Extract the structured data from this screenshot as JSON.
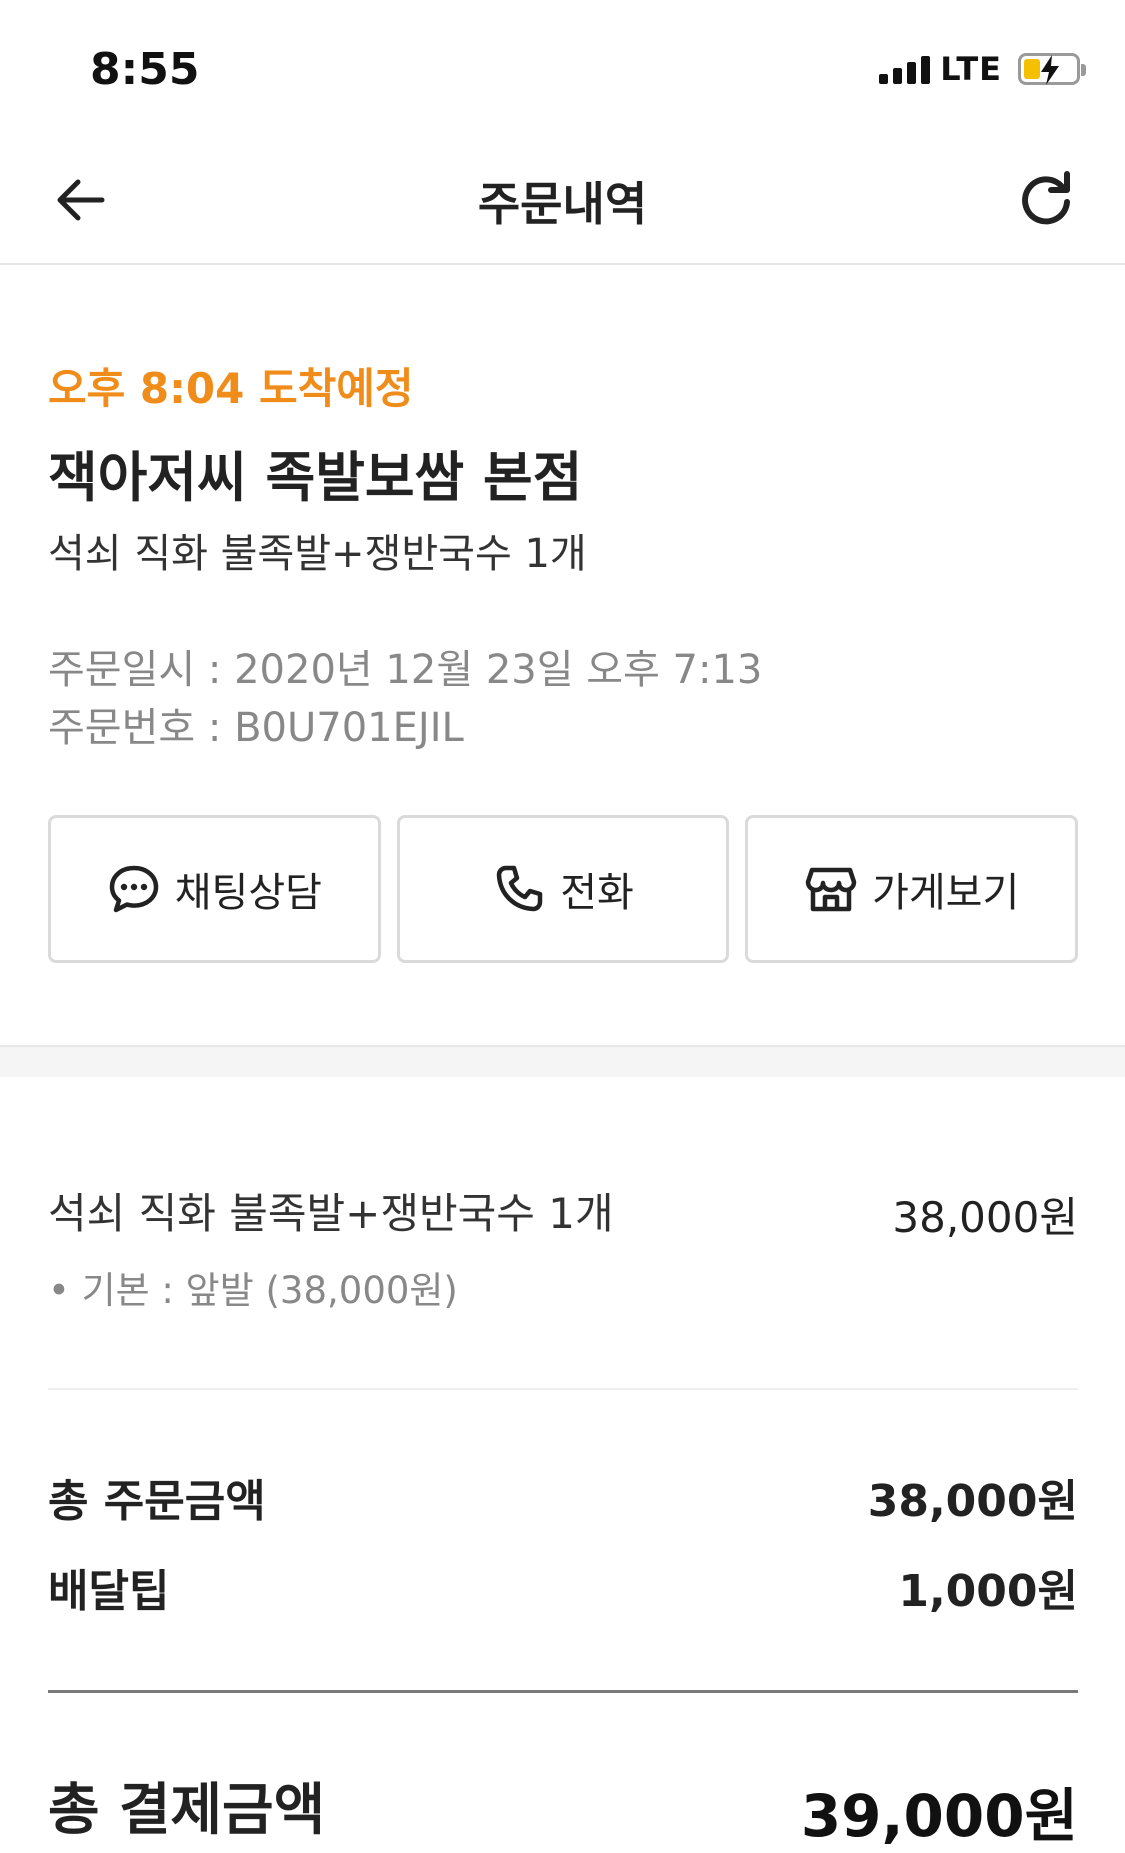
{
  "status_bar": {
    "time": "8:55",
    "network": "LTE",
    "icons": [
      "signal-icon",
      "battery-charging-icon"
    ]
  },
  "nav": {
    "title": "주문내역",
    "back_icon": "arrow-left-icon",
    "refresh_icon": "refresh-icon"
  },
  "order": {
    "eta": "오후 8:04 도착예정",
    "store_name": "잭아저씨 족발보쌈 본점",
    "menu_summary": "석쇠 직화 불족발+쟁반국수 1개",
    "order_datetime": "주문일시 : 2020년 12월 23일 오후 7:13",
    "order_number": "주문번호 : B0U701EJIL"
  },
  "actions": [
    {
      "label": "채팅상담",
      "icon": "chat-bubble-icon"
    },
    {
      "label": "전화",
      "icon": "phone-icon"
    },
    {
      "label": "가게보기",
      "icon": "store-icon"
    }
  ],
  "items": [
    {
      "name": "석쇠 직화 불족발+쟁반국수 1개",
      "price": "38,000원",
      "option": "• 기본 : 앞발 (38,000원)"
    }
  ],
  "summary": {
    "order_amount_label": "총 주문금액",
    "order_amount": "38,000원",
    "delivery_tip_label": "배달팁",
    "delivery_tip": "1,000원"
  },
  "total": {
    "label": "총 결제금액",
    "value": "39,000원"
  },
  "colors": {
    "accent": "#f08c1a",
    "text": "#222222",
    "muted": "#888888",
    "border": "#dadada"
  }
}
